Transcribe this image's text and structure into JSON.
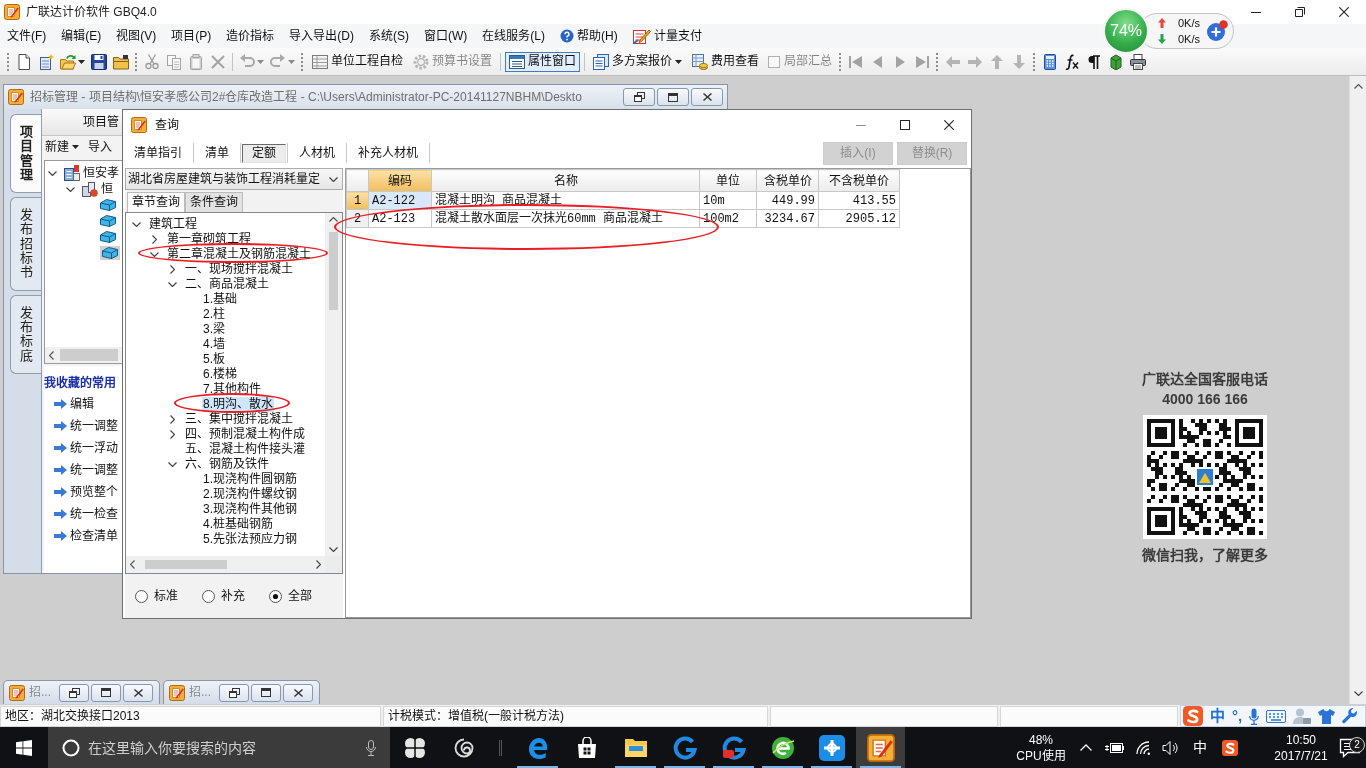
{
  "app": {
    "title": "广联达计价软件 GBQ4.0"
  },
  "menu": [
    {
      "kind": "text",
      "label": "文件(F)"
    },
    {
      "kind": "text",
      "label": "编辑(E)"
    },
    {
      "kind": "text",
      "label": "视图(V)"
    },
    {
      "kind": "text",
      "label": "项目(P)"
    },
    {
      "kind": "text",
      "label": "造价指标"
    },
    {
      "kind": "text",
      "label": "导入导出(D)"
    },
    {
      "kind": "text",
      "label": "系统(S)"
    },
    {
      "kind": "text",
      "label": "窗口(W)"
    },
    {
      "kind": "text",
      "label": "在线服务(L)"
    },
    {
      "kind": "help",
      "label": "帮助(H)"
    },
    {
      "kind": "pay",
      "label": "计量支付"
    }
  ],
  "toolbar": [
    {
      "kind": "grip"
    },
    {
      "kind": "icon",
      "disabled": false
    },
    {
      "kind": "icon",
      "disabled": false
    },
    {
      "kind": "icon",
      "disabled": false,
      "menu": true
    },
    {
      "kind": "icon",
      "disabled": false
    },
    {
      "kind": "icon",
      "disabled": false
    },
    {
      "kind": "grip"
    },
    {
      "kind": "icon",
      "disabled": true
    },
    {
      "kind": "icon",
      "disabled": true
    },
    {
      "kind": "icon",
      "disabled": true
    },
    {
      "kind": "icon",
      "disabled": true
    },
    {
      "kind": "sep"
    },
    {
      "kind": "icon",
      "disabled": true,
      "menu": true
    },
    {
      "kind": "icon",
      "disabled": true,
      "menu": true
    },
    {
      "kind": "grip"
    },
    {
      "kind": "button",
      "label": "单位工程自检",
      "disabled": false,
      "pressed": false
    },
    {
      "kind": "button",
      "label": "预算书设置",
      "disabled": true,
      "pressed": false
    },
    {
      "kind": "sep"
    },
    {
      "kind": "button",
      "label": "属性窗口",
      "disabled": false,
      "pressed": true
    },
    {
      "kind": "sep"
    },
    {
      "kind": "button",
      "label": "多方案报价",
      "disabled": false,
      "pressed": false,
      "menu": true
    },
    {
      "kind": "button",
      "label": "费用查看",
      "disabled": false,
      "pressed": false
    },
    {
      "kind": "check",
      "label": "局部汇总",
      "checked": false,
      "disabled": true
    },
    {
      "kind": "grip"
    },
    {
      "kind": "icon",
      "disabled": true
    },
    {
      "kind": "icon",
      "disabled": true
    },
    {
      "kind": "icon",
      "disabled": true
    },
    {
      "kind": "icon",
      "disabled": true
    },
    {
      "kind": "grip"
    },
    {
      "kind": "icon",
      "disabled": true
    },
    {
      "kind": "icon",
      "disabled": true
    },
    {
      "kind": "icon",
      "disabled": true
    },
    {
      "kind": "icon",
      "disabled": true
    },
    {
      "kind": "grip"
    },
    {
      "kind": "icon",
      "disabled": false
    },
    {
      "kind": "icon",
      "disabled": false
    },
    {
      "kind": "icon",
      "disabled": false
    },
    {
      "kind": "icon",
      "disabled": false
    },
    {
      "kind": "icon",
      "disabled": false
    }
  ],
  "net_monitor": {
    "load": "74%",
    "upload": "0K/s",
    "download": "0K/s"
  },
  "project_window": {
    "title": "招标管理 - 项目结构\\恒安孝感公司2#仓库改造工程 - C:\\Users\\Administrator-PC-20141127NBHM\\Deskto",
    "side_tabs": [
      {
        "label": "项目管理",
        "selected": true
      },
      {
        "label": "发布招标书",
        "selected": false
      },
      {
        "label": "发布标底",
        "selected": false
      }
    ],
    "panel_title": "项目管",
    "actions": [
      {
        "label": "新建",
        "menu": true
      },
      {
        "label": "导入",
        "menu": false
      }
    ],
    "tree": [
      {
        "label": "恒安孝",
        "expanded": true,
        "selected": false,
        "children": [
          {
            "label": "恒",
            "expanded": true,
            "selected": false,
            "children": [
              {
                "selected": false
              },
              {
                "selected": false
              },
              {
                "selected": false
              },
              {
                "selected": true
              }
            ]
          }
        ]
      }
    ],
    "favorites_title": "我收藏的常用",
    "favorites": [
      "编辑",
      "统一调整",
      "统一浮动",
      "统一调整",
      "预览整个",
      "统一检查",
      "检查清单"
    ]
  },
  "minimized_windows": [
    {
      "title": "招..."
    },
    {
      "title": "招..."
    }
  ],
  "query_dialog": {
    "title": "查询",
    "window_controls": [
      {
        "kind": "minimize",
        "disabled": true
      },
      {
        "kind": "maximize",
        "disabled": false
      },
      {
        "kind": "close",
        "disabled": false
      }
    ],
    "tabs": [
      {
        "label": "清单指引",
        "selected": false
      },
      {
        "label": "清单",
        "selected": false
      },
      {
        "label": "定额",
        "selected": true
      },
      {
        "label": "人材机",
        "selected": false
      },
      {
        "label": "补充人材机",
        "selected": false
      }
    ],
    "buttons": [
      {
        "label": "插入(I)",
        "disabled": true
      },
      {
        "label": "替换(R)",
        "disabled": true
      }
    ],
    "library": "湖北省房屋建筑与装饰工程消耗量定",
    "search_tabs": [
      {
        "label": "章节查询",
        "selected": true
      },
      {
        "label": "条件查询",
        "selected": false
      }
    ],
    "tree": [
      {
        "label": "建筑工程",
        "expanded": true,
        "selected": false,
        "circled": false,
        "children": [
          {
            "label": "第一章砌筑工程",
            "expanded": false,
            "selected": false,
            "circled": false
          },
          {
            "label": "第二章混凝土及钢筋混凝土",
            "expanded": true,
            "selected": false,
            "circled": true,
            "children": [
              {
                "label": "一、现场搅拌混凝土",
                "expanded": false,
                "selected": false,
                "circled": false
              },
              {
                "label": "二、商品混凝土",
                "expanded": true,
                "selected": false,
                "circled": false,
                "children": [
                  {
                    "label": "1.基础",
                    "selected": false,
                    "circled": false
                  },
                  {
                    "label": "2.柱",
                    "selected": false,
                    "circled": false
                  },
                  {
                    "label": "3.梁",
                    "selected": false,
                    "circled": false
                  },
                  {
                    "label": "4.墙",
                    "selected": false,
                    "circled": false
                  },
                  {
                    "label": "5.板",
                    "selected": false,
                    "circled": false
                  },
                  {
                    "label": "6.楼梯",
                    "selected": false,
                    "circled": false
                  },
                  {
                    "label": "7.其他构件",
                    "selected": false,
                    "circled": false
                  },
                  {
                    "label": "8.明沟、散水",
                    "selected": true,
                    "circled": true
                  }
                ]
              },
              {
                "label": "三、集中搅拌混凝土",
                "expanded": false,
                "selected": false,
                "circled": false
              },
              {
                "label": "四、预制混凝土构件成",
                "expanded": false,
                "selected": false,
                "circled": false
              },
              {
                "label": "五、混凝土构件接头灌",
                "selected": false,
                "circled": false
              },
              {
                "label": "六、钢筋及铁件",
                "expanded": true,
                "selected": false,
                "circled": false,
                "children": [
                  {
                    "label": "1.现浇构件圆钢筋",
                    "selected": false,
                    "circled": false
                  },
                  {
                    "label": "2.现浇构件螺纹钢",
                    "selected": false,
                    "circled": false
                  },
                  {
                    "label": "3.现浇构件其他钢",
                    "selected": false,
                    "circled": false
                  },
                  {
                    "label": "4.桩基础钢筋",
                    "selected": false,
                    "circled": false
                  },
                  {
                    "label": "5.先张法预应力钢",
                    "selected": false,
                    "circled": false
                  }
                ]
              }
            ]
          }
        ]
      }
    ],
    "filters": [
      {
        "label": "标准",
        "selected": false
      },
      {
        "label": "补充",
        "selected": false
      },
      {
        "label": "全部",
        "selected": true
      }
    ],
    "table": {
      "columns": [
        {
          "label": "编码",
          "selected": true
        },
        {
          "label": "名称",
          "selected": false
        },
        {
          "label": "单位",
          "selected": false
        },
        {
          "label": "含税单价",
          "selected": false
        },
        {
          "label": "不含税单价",
          "selected": false
        }
      ],
      "rows": [
        {
          "number": "1",
          "selected": true,
          "circled": false,
          "cells": [
            "A2-122",
            "混凝土明沟 商品混凝土",
            "10m",
            "449.99",
            "413.55"
          ]
        },
        {
          "number": "2",
          "selected": false,
          "circled": true,
          "cells": [
            "A2-123",
            "混凝土散水面层一次抹光60mm 商品混凝土",
            "100m2",
            "3234.67",
            "2905.12"
          ]
        }
      ]
    }
  },
  "service": {
    "title": "广联达全国客服电话",
    "phone": "4000 166 166",
    "caption": "微信扫我，了解更多"
  },
  "status_bar": {
    "panes": [
      "地区：湖北交换接口2013",
      "计税模式：增值税(一般计税方法)"
    ]
  },
  "ime_bar": {
    "mode": "中",
    "punctuation": "°,"
  },
  "taskbar": {
    "search": {
      "placeholder": "在这里输入你要搜索的内容"
    },
    "apps": [
      {
        "running": false,
        "active": false
      },
      {
        "running": false,
        "active": false
      },
      {
        "running": true,
        "active": false
      },
      {
        "running": false,
        "active": false
      },
      {
        "running": true,
        "active": false
      },
      {
        "running": true,
        "active": false
      },
      {
        "running": true,
        "active": false
      },
      {
        "running": true,
        "active": false
      },
      {
        "running": true,
        "active": false
      },
      {
        "running": true,
        "active": true
      }
    ],
    "cpu": {
      "value": "48%",
      "label": "CPU使用"
    },
    "input_mode": "中",
    "clock": {
      "time": "10:50",
      "date": "2017/7/21"
    },
    "notifications": "2"
  }
}
